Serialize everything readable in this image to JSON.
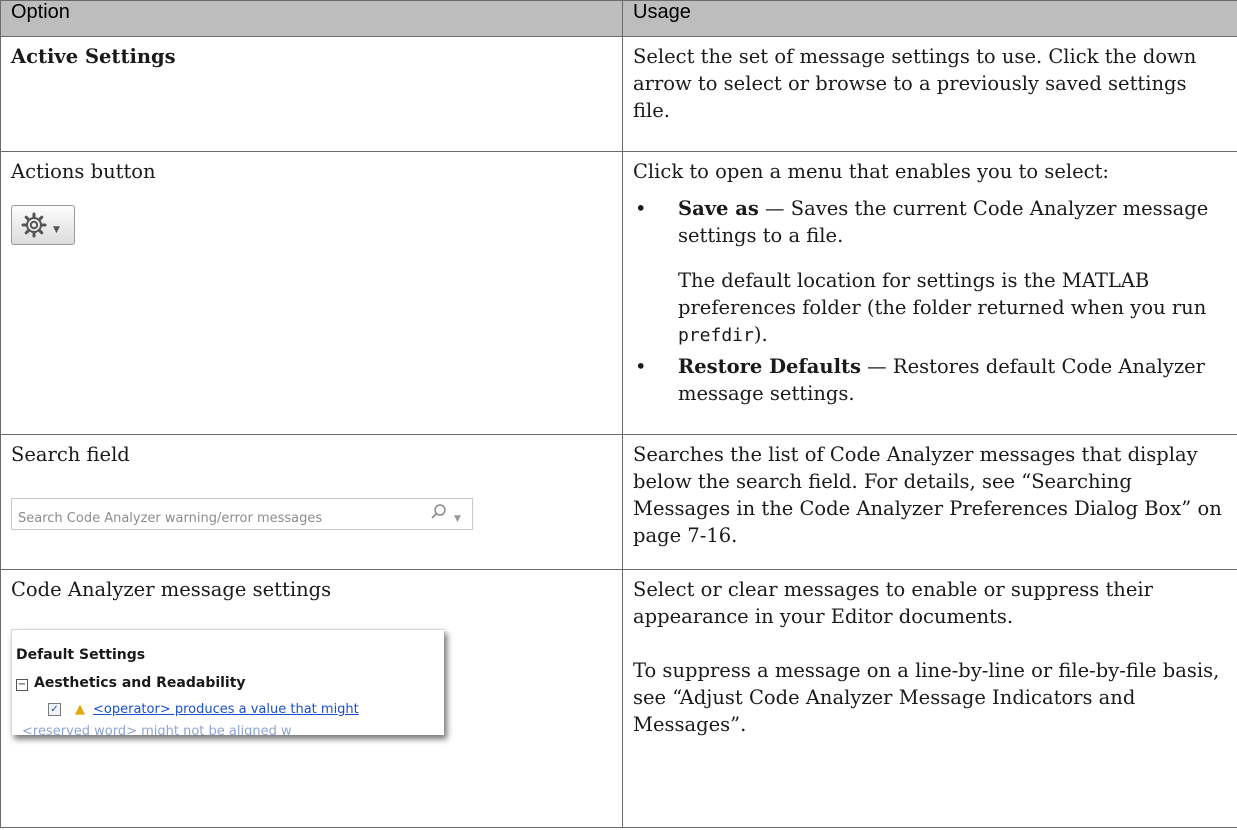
{
  "headers": {
    "option": "Option",
    "usage": "Usage"
  },
  "rows": {
    "active": {
      "option": "Active Settings",
      "usage": "Select the set of message settings to use. Click the down arrow to select or browse to a previously saved settings file."
    },
    "actions": {
      "option": "Actions button",
      "usage_intro": "Click to open a menu that enables you to select:",
      "save_bold": "Save as",
      "save_text": " — Saves the current Code Analyzer message settings to a file.",
      "save_note_pre": "The default location for settings is the MATLAB preferences folder (the folder returned when you run ",
      "save_note_code": "prefdir",
      "save_note_post": ").",
      "restore_bold": "Restore Defaults",
      "restore_text": " — Restores default Code Analyzer message settings.",
      "bullet": "•",
      "icon": "gear-icon"
    },
    "search": {
      "option": "Search field",
      "placeholder": "Search Code Analyzer warning/error messages",
      "usage": "Searches the list of Code Analyzer messages that display below the search field. For details, see “Searching Messages in the Code Analyzer Preferences Dialog Box” on page 7-16."
    },
    "settings": {
      "option": "Code Analyzer message settings",
      "img_title": "Default Settings",
      "img_group": "Aesthetics and Readability",
      "img_item1": "<operator> produces a value that might",
      "img_item2": "<reserved word> might not be aligned w",
      "usage_p1": "Select or clear messages to enable or suppress their appearance in your Editor documents.",
      "usage_p2": "To suppress a message on a line-by-line or file-by-file basis, see “Adjust Code Analyzer Message Indicators and Messages”."
    }
  },
  "colors": {
    "header_bg": "#bdbdbd",
    "border": "#6b6b6b",
    "link": "#1a4fd0",
    "warning": "#e0a800"
  }
}
